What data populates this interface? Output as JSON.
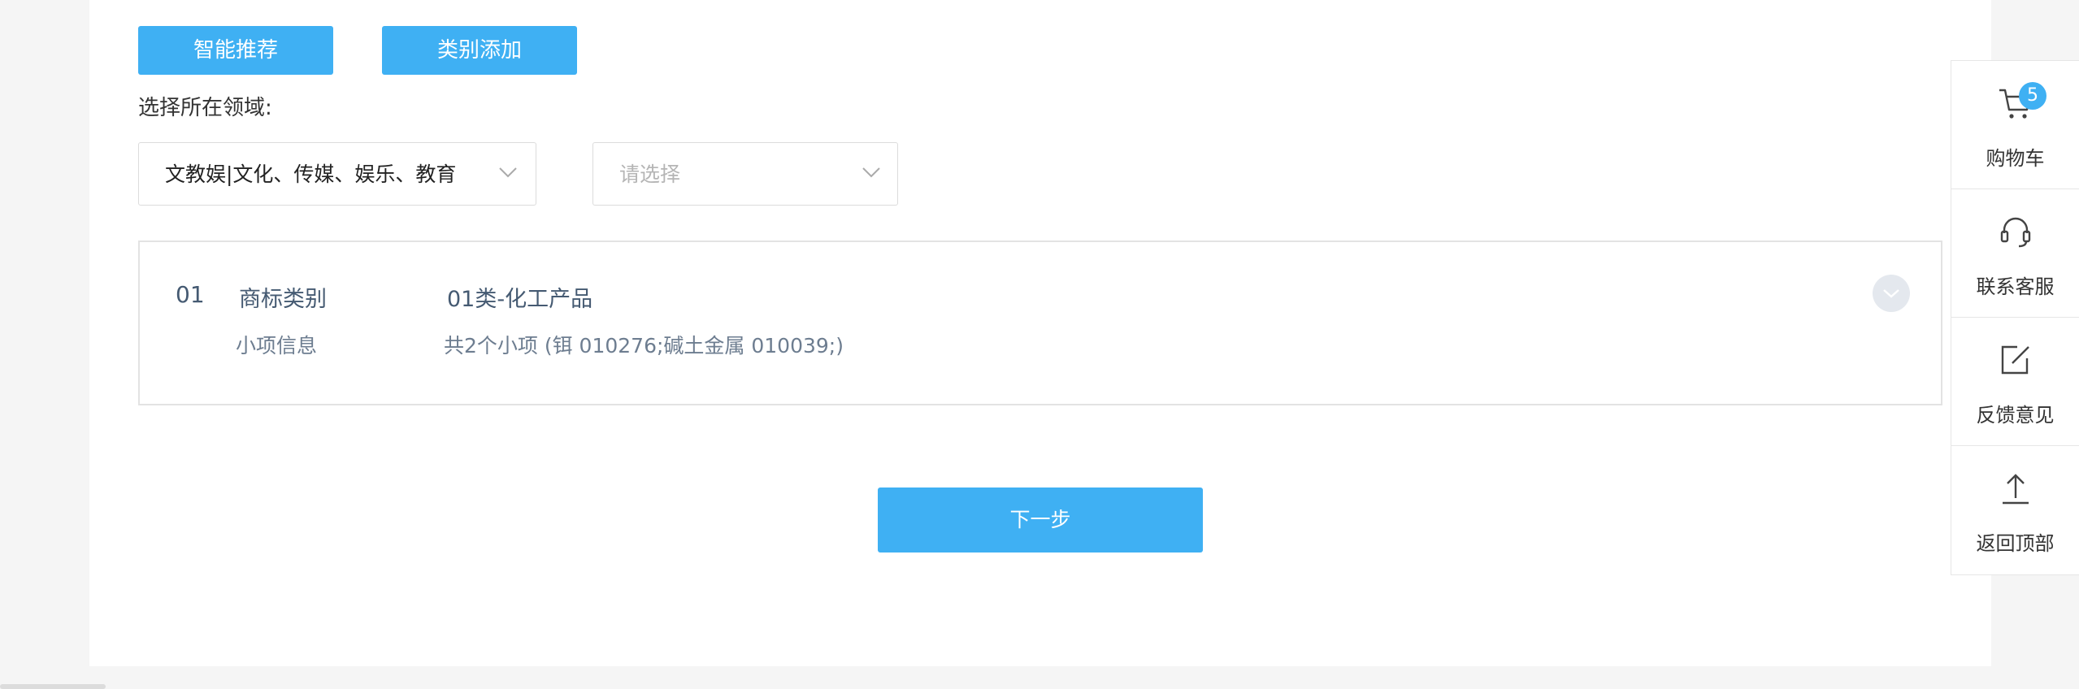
{
  "buttons": {
    "smart_recommend": "智能推荐",
    "category_add": "类别添加",
    "next": "下一步"
  },
  "domain_select": {
    "label": "选择所在领域:",
    "first_value": "文教娱|文化、传媒、娱乐、教育",
    "second_placeholder": "请选择"
  },
  "class_card": {
    "number": "01",
    "category_label": "商标类别",
    "category_value": "01类-化工产品",
    "sub_label": "小项信息",
    "sub_value": "共2个小项 (铒 010276;碱土金属 010039;)"
  },
  "sidebar": {
    "cart": {
      "label": "购物车",
      "badge": "5",
      "icon": "cart-icon"
    },
    "support": {
      "label": "联系客服",
      "icon": "headset-icon"
    },
    "feedback": {
      "label": "反馈意见",
      "icon": "edit-icon"
    },
    "top": {
      "label": "返回顶部",
      "icon": "arrow-up-icon"
    }
  },
  "colors": {
    "accent": "#3fb0f3",
    "background": "#f5f5f5",
    "card_text": "#455a72"
  }
}
